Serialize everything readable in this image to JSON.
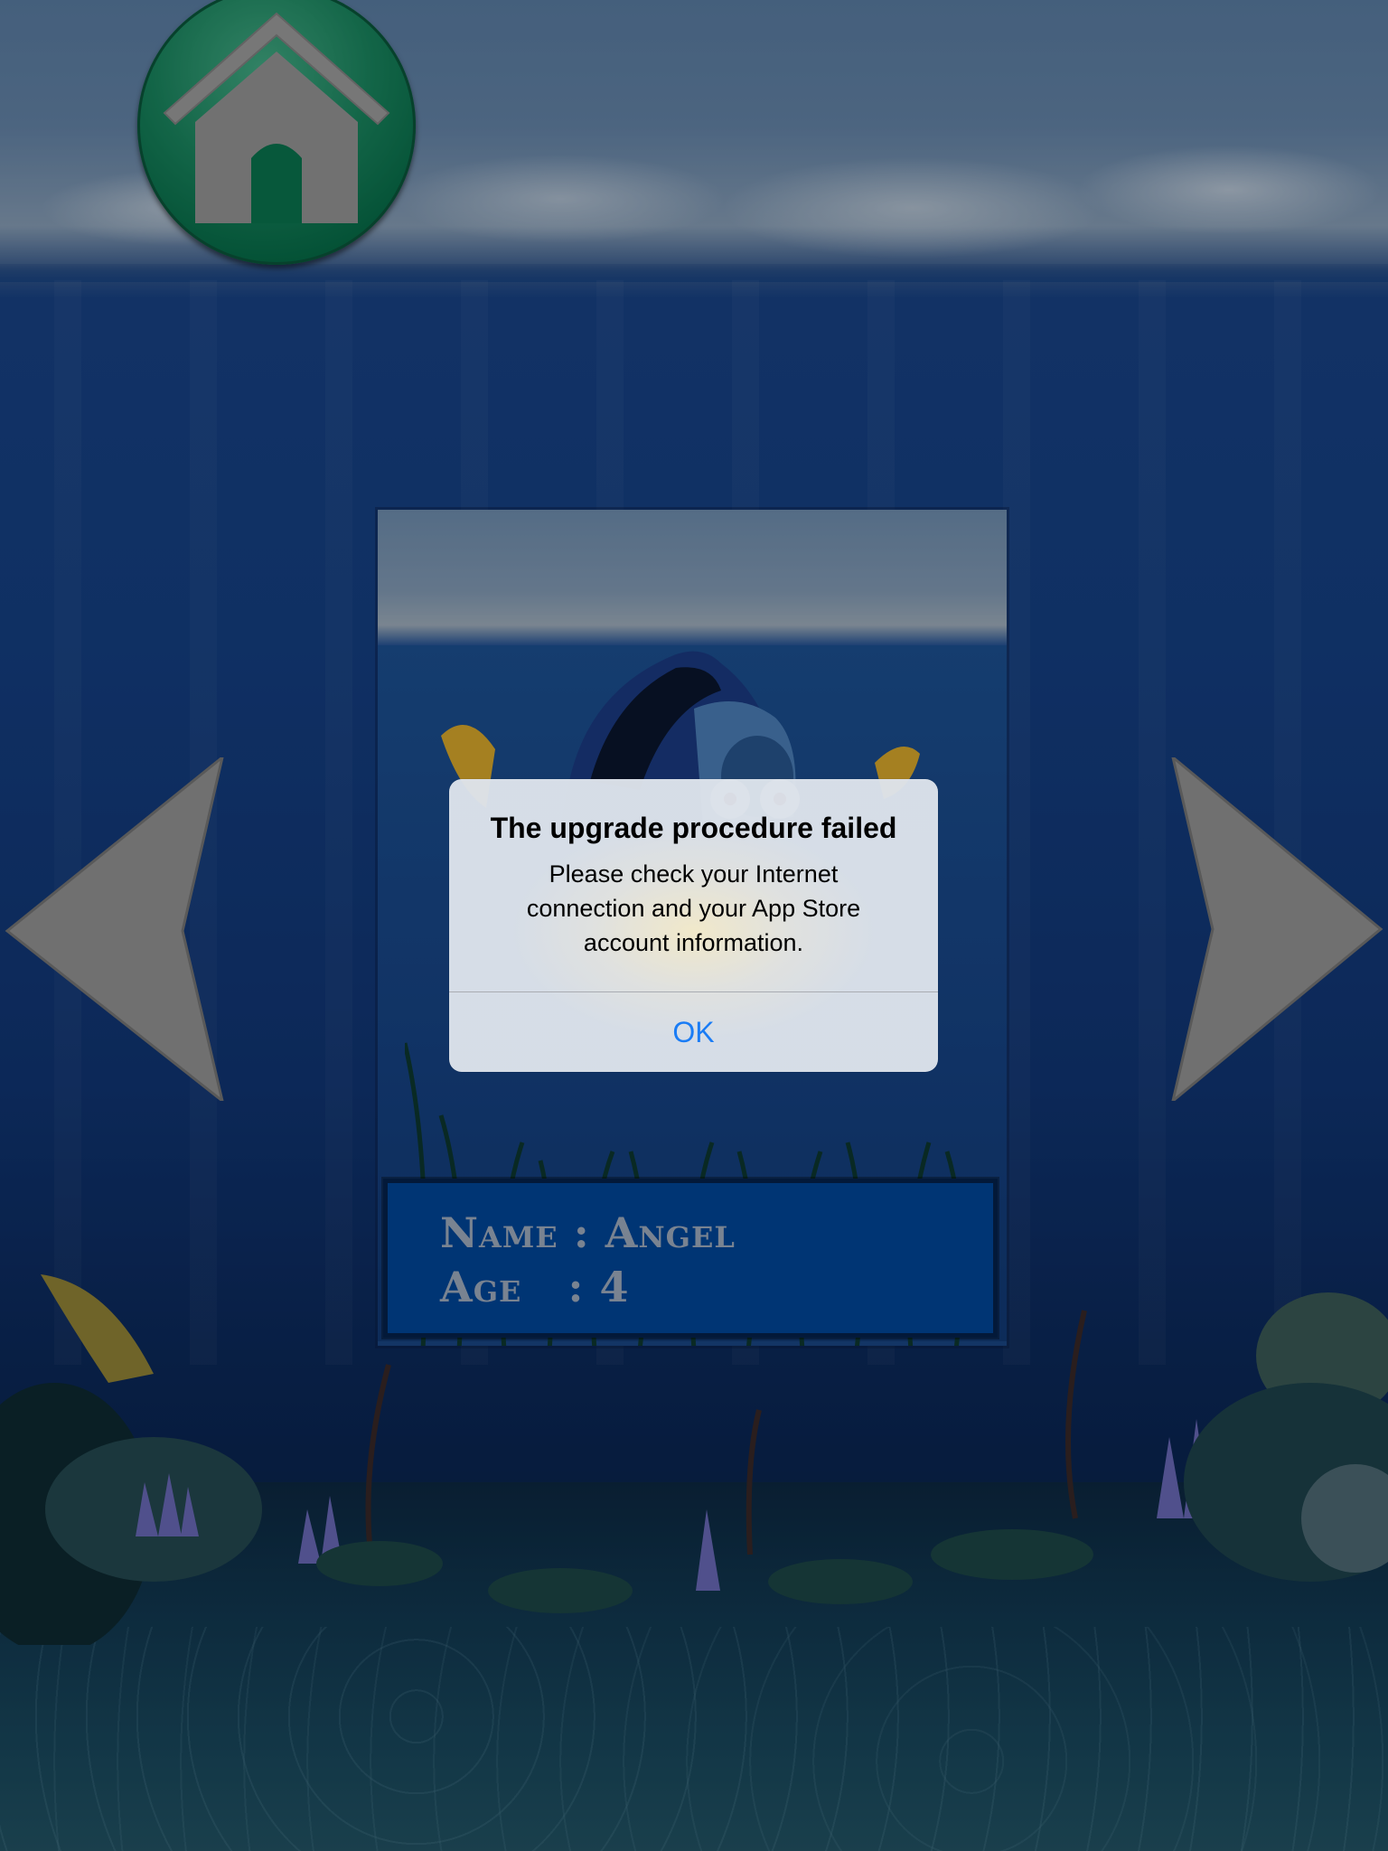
{
  "app": {
    "home_button_icon": "home-icon",
    "prev_arrow_icon": "left-arrow-icon",
    "next_arrow_icon": "right-arrow-icon"
  },
  "fish_card": {
    "image": "blue-tang-fish",
    "name_line": "Name : Angel",
    "age_line": "Age   : 4"
  },
  "alert": {
    "title": "The upgrade procedure failed",
    "message": "Please check your Internet connection and your App Store account information.",
    "ok_label": "OK"
  },
  "colors": {
    "ok_blue": "#1a7cf5",
    "home_green": "#05704a",
    "nameplate_blue": "#004aa1"
  }
}
